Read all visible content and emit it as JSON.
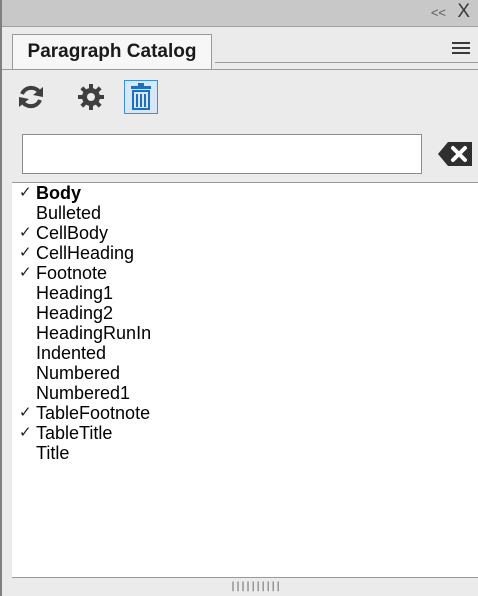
{
  "titlebar": {
    "collapse_glyph": "<<",
    "close_glyph": "X"
  },
  "tab": {
    "label": "Paragraph Catalog"
  },
  "toolbar": {
    "buttons": [
      {
        "icon": "refresh-icon"
      },
      {
        "icon": "gear-icon"
      },
      {
        "icon": "delete-icon",
        "active": true
      }
    ]
  },
  "search": {
    "value": "",
    "placeholder": ""
  },
  "list": {
    "items": [
      {
        "label": "Body",
        "checked": true,
        "bold": true
      },
      {
        "label": "Bulleted",
        "checked": false
      },
      {
        "label": "CellBody",
        "checked": true
      },
      {
        "label": "CellHeading",
        "checked": true
      },
      {
        "label": "Footnote",
        "checked": true
      },
      {
        "label": "Heading1",
        "checked": false
      },
      {
        "label": "Heading2",
        "checked": false
      },
      {
        "label": "HeadingRunIn",
        "checked": false
      },
      {
        "label": "Indented",
        "checked": false
      },
      {
        "label": "Numbered",
        "checked": false
      },
      {
        "label": "Numbered1",
        "checked": false
      },
      {
        "label": "TableFootnote",
        "checked": true
      },
      {
        "label": "TableTitle",
        "checked": true
      },
      {
        "label": "Title",
        "checked": false
      }
    ],
    "check_glyph": "✓"
  },
  "colors": {
    "accent": "#1e6fc0",
    "titlebar": "#c8c8c8",
    "panel": "#ebebeb"
  }
}
